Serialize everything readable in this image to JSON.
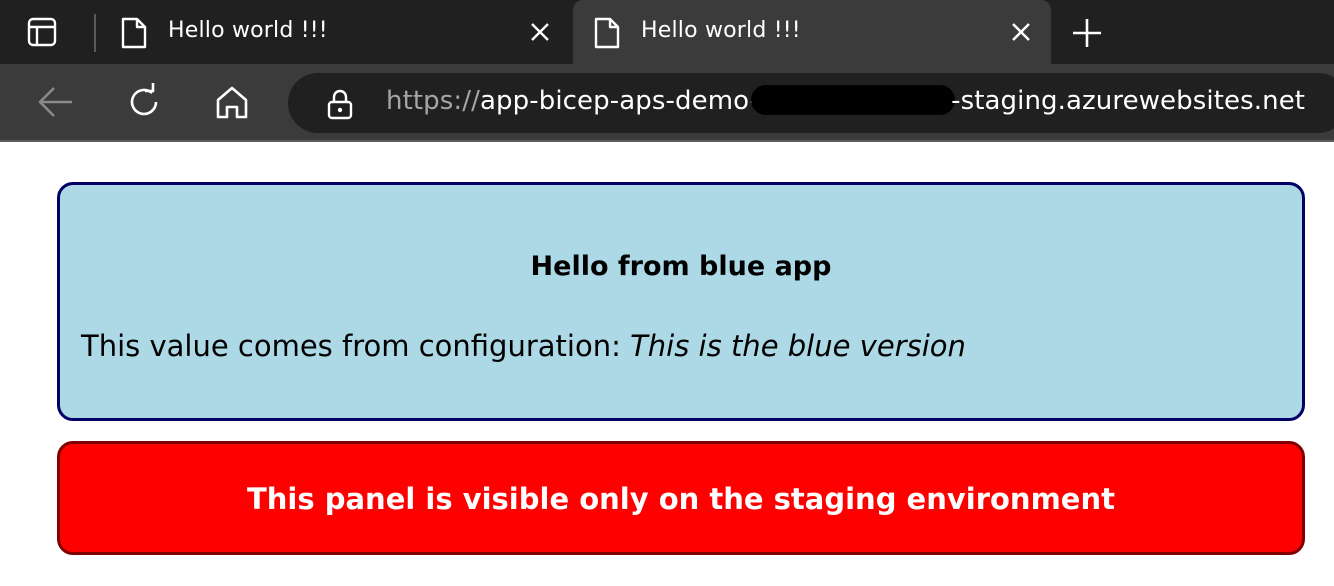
{
  "browser": {
    "tabs": [
      {
        "title": "Hello world !!!",
        "active": false
      },
      {
        "title": "Hello world !!!",
        "active": true
      }
    ],
    "address": {
      "scheme": "https://",
      "host_prefix": "app-bicep-aps-demo-",
      "host_suffix": "-staging.azurewebsites.net"
    },
    "icons": {
      "tab_actions": "tab-actions-icon",
      "page": "page-icon",
      "close": "close-icon",
      "new_tab": "plus-icon",
      "back": "back-arrow-icon",
      "refresh": "refresh-icon",
      "home": "home-icon",
      "lock": "lock-icon"
    }
  },
  "page": {
    "blue_panel": {
      "heading": "Hello from blue app",
      "config_prefix": "This value comes from configuration: ",
      "config_value": "This is the blue version",
      "background": "#add8e6",
      "border": "#000066"
    },
    "red_panel": {
      "message": "This panel is visible only on the staging environment",
      "background": "#ff0000",
      "border": "#800000"
    }
  }
}
